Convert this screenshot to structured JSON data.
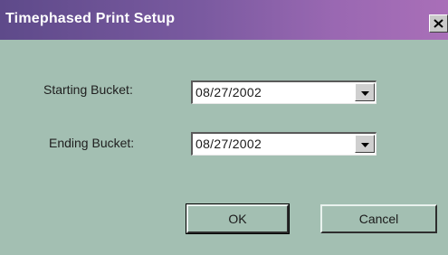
{
  "dialog": {
    "title": "Timephased Print Setup",
    "close_glyph": "close-icon"
  },
  "fields": {
    "starting_bucket": {
      "label": "Starting Bucket:",
      "value": "08/27/2002"
    },
    "ending_bucket": {
      "label": "Ending Bucket:",
      "value": "08/27/2002"
    }
  },
  "buttons": {
    "ok_label": "OK",
    "cancel_label": "Cancel"
  },
  "colors": {
    "dialog_background": "#a3bfb2",
    "titlebar_start": "#5e4a8a",
    "titlebar_end": "#a96fb8"
  }
}
